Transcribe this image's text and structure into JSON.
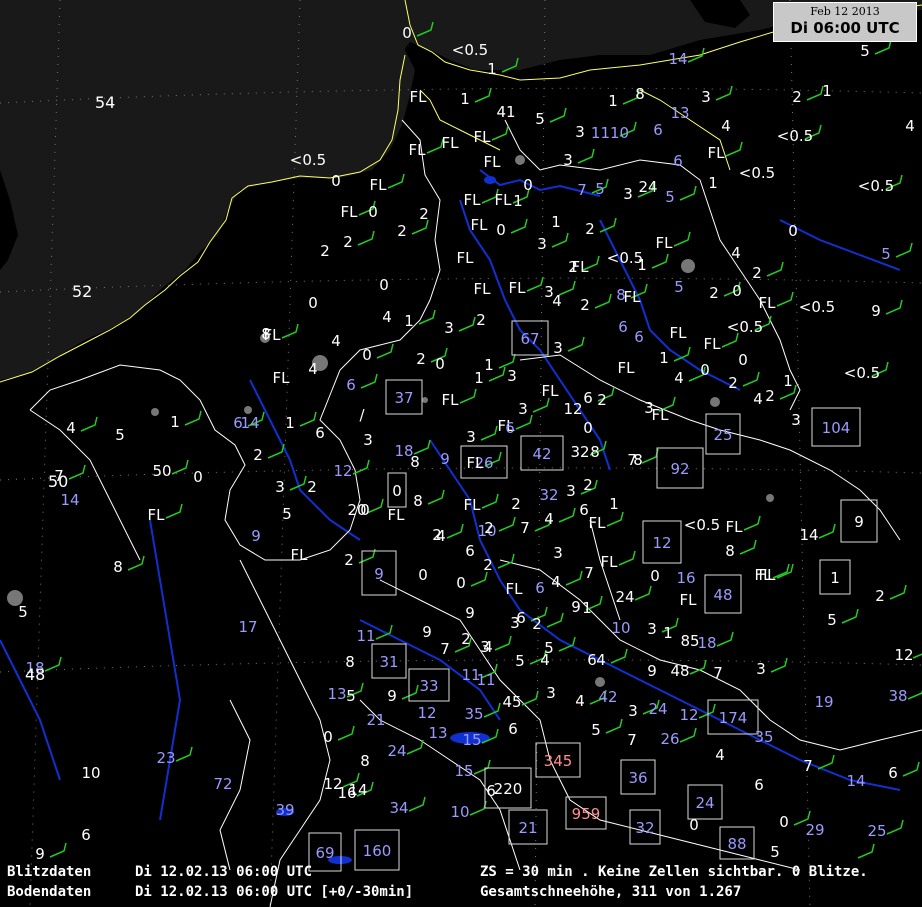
{
  "header": {
    "date": "Feb 12 2013",
    "time": "Di 06:00 UTC"
  },
  "latitude_labels": [
    "54",
    "52",
    "50",
    "48"
  ],
  "footer": {
    "row1_label": "Blitzdaten",
    "row1_time": "Di 12.02.13 06:00 UTC",
    "row1_info": "ZS = 30 min . Keine Zellen sichtbar. 0 Blitze.",
    "row2_label": "Bodendaten",
    "row2_time": "Di 12.02.13 06:00 UTC [+0/-30min]",
    "row2_info": "Gesamtschneehöhe, 311 von 1.267"
  },
  "colors": {
    "land": "#191919",
    "sea": "#000000",
    "coast": "#ffff66",
    "border": "#ffffff",
    "river": "#1030d0",
    "wind": "#22cc22",
    "value_white": "#ffffff",
    "value_blue": "#9a9aff",
    "value_red": "#ff8f8f"
  },
  "observations": [
    {
      "t": "0",
      "c": "w"
    },
    {
      "t": "<0.5",
      "c": "w"
    },
    {
      "t": "1",
      "c": "w"
    },
    {
      "t": "FL",
      "c": "w"
    },
    {
      "t": "1",
      "c": "w"
    },
    {
      "t": "41",
      "c": "w"
    },
    {
      "t": "5",
      "c": "w"
    },
    {
      "t": "3",
      "c": "w"
    },
    {
      "t": "1110",
      "c": "b"
    },
    {
      "t": "6",
      "c": "b"
    },
    {
      "t": "1",
      "c": "w"
    },
    {
      "t": "8",
      "c": "w"
    },
    {
      "t": "14",
      "c": "b"
    },
    {
      "t": "13",
      "c": "b"
    },
    {
      "t": "3",
      "c": "w"
    },
    {
      "t": "4",
      "c": "w"
    },
    {
      "t": "2",
      "c": "w"
    },
    {
      "t": "1",
      "c": "w"
    },
    {
      "t": "5",
      "c": "w"
    },
    {
      "t": "4",
      "c": "w"
    },
    {
      "t": "FL",
      "c": "w"
    },
    {
      "t": "FL",
      "c": "w"
    },
    {
      "t": "FL",
      "c": "w"
    },
    {
      "t": "FL",
      "c": "w"
    },
    {
      "t": "3",
      "c": "w"
    },
    {
      "t": "6",
      "c": "b"
    },
    {
      "t": "FL",
      "c": "w"
    },
    {
      "t": "<0.5",
      "c": "w"
    },
    {
      "t": "<0.5",
      "c": "w"
    },
    {
      "t": "<0.5",
      "c": "w"
    },
    {
      "t": "<0.5",
      "c": "w"
    },
    {
      "t": "0",
      "c": "w"
    },
    {
      "t": "FL",
      "c": "w"
    },
    {
      "t": "0",
      "c": "w"
    },
    {
      "t": "7",
      "c": "b"
    },
    {
      "t": "5",
      "c": "b"
    },
    {
      "t": "3",
      "c": "w"
    },
    {
      "t": "24",
      "c": "w"
    },
    {
      "t": "5",
      "c": "b"
    },
    {
      "t": "1",
      "c": "w"
    },
    {
      "t": "FL",
      "c": "w"
    },
    {
      "t": "0",
      "c": "w"
    },
    {
      "t": "FL",
      "c": "w"
    },
    {
      "t": "1",
      "c": "w"
    },
    {
      "t": "2",
      "c": "w"
    },
    {
      "t": "2",
      "c": "w"
    },
    {
      "t": "FL",
      "c": "w"
    },
    {
      "t": "FL",
      "c": "w"
    },
    {
      "t": "0",
      "c": "w"
    },
    {
      "t": "1",
      "c": "w"
    },
    {
      "t": "2",
      "c": "w"
    },
    {
      "t": "0",
      "c": "w"
    },
    {
      "t": "5",
      "c": "b"
    },
    {
      "t": "2",
      "c": "w"
    },
    {
      "t": "2",
      "c": "w"
    },
    {
      "t": "<0.5",
      "c": "w"
    },
    {
      "t": "1",
      "c": "w"
    },
    {
      "t": "FL",
      "c": "w"
    },
    {
      "t": "FL",
      "c": "w"
    },
    {
      "t": "4",
      "c": "w"
    },
    {
      "t": "3",
      "c": "w"
    },
    {
      "t": "5",
      "c": "b"
    },
    {
      "t": "2",
      "c": "w"
    },
    {
      "t": "FL",
      "c": "w"
    },
    {
      "t": "2",
      "c": "w"
    },
    {
      "t": "FL",
      "c": "w"
    },
    {
      "t": "2",
      "c": "w"
    },
    {
      "t": "0",
      "c": "w"
    },
    {
      "t": "FL",
      "c": "w"
    },
    {
      "t": "0",
      "c": "w"
    },
    {
      "t": "3",
      "c": "w"
    },
    {
      "t": "4",
      "c": "w"
    },
    {
      "t": "2",
      "c": "w"
    },
    {
      "t": "6",
      "c": "b"
    },
    {
      "t": "8",
      "c": "b"
    },
    {
      "t": "FL",
      "c": "w"
    },
    {
      "t": "FL",
      "c": "w"
    },
    {
      "t": "4",
      "c": "w"
    },
    {
      "t": "1",
      "c": "w"
    },
    {
      "t": "0",
      "c": "w"
    },
    {
      "t": "3",
      "c": "w"
    },
    {
      "t": "2",
      "c": "w"
    },
    {
      "t": "3",
      "c": "w"
    },
    {
      "t": "6",
      "c": "b"
    },
    {
      "t": "1",
      "c": "w"
    },
    {
      "t": "FL",
      "c": "w"
    },
    {
      "t": "<0.5",
      "c": "w"
    },
    {
      "t": "<0.5",
      "c": "w"
    },
    {
      "t": "9",
      "c": "w"
    },
    {
      "t": "8",
      "c": "w"
    },
    {
      "t": "FL",
      "c": "w"
    },
    {
      "t": "4",
      "c": "w"
    },
    {
      "t": "0",
      "c": "w"
    },
    {
      "t": "4",
      "c": "w"
    },
    {
      "t": "2",
      "c": "w"
    },
    {
      "t": "0",
      "c": "w"
    },
    {
      "t": "1",
      "c": "w"
    },
    {
      "t": "3",
      "c": "w"
    },
    {
      "t": "1",
      "c": "w"
    },
    {
      "t": "FL",
      "c": "w"
    },
    {
      "t": "FL",
      "c": "w"
    },
    {
      "t": "0",
      "c": "w"
    },
    {
      "t": "4",
      "c": "w"
    },
    {
      "t": "0",
      "c": "w"
    },
    {
      "t": "<0.5",
      "c": "w"
    },
    {
      "t": "FL",
      "c": "w"
    },
    {
      "t": "6",
      "c": "b"
    },
    {
      "t": "FL",
      "c": "w"
    },
    {
      "t": "2",
      "c": "w"
    },
    {
      "t": "1",
      "c": "w"
    },
    {
      "t": "FL",
      "c": "w"
    },
    {
      "t": "4",
      "c": "w"
    },
    {
      "t": "6",
      "c": "w"
    },
    {
      "t": "2",
      "c": "w"
    },
    {
      "t": "3",
      "c": "w"
    },
    {
      "t": "FL",
      "c": "w"
    },
    {
      "t": "3",
      "c": "w"
    },
    {
      "t": "12",
      "c": "w"
    },
    {
      "t": "2",
      "c": "w"
    },
    {
      "t": "3",
      "c": "w"
    },
    {
      "t": "4",
      "c": "w"
    },
    {
      "t": "5",
      "c": "w"
    },
    {
      "t": "1",
      "c": "w"
    },
    {
      "t": "/",
      "c": "w"
    },
    {
      "t": "6",
      "c": "b"
    },
    {
      "t": "14",
      "c": "b"
    },
    {
      "t": "1",
      "c": "w"
    },
    {
      "t": "6",
      "c": "w"
    },
    {
      "t": "FL",
      "c": "w"
    },
    {
      "t": "0",
      "c": "w"
    },
    {
      "t": "3",
      "c": "w"
    },
    {
      "t": "6",
      "c": "b"
    },
    {
      "t": "2",
      "c": "w"
    },
    {
      "t": "3",
      "c": "w"
    },
    {
      "t": "18",
      "c": "b"
    },
    {
      "t": "9",
      "c": "b"
    },
    {
      "t": "32",
      "c": "w"
    },
    {
      "t": "8",
      "c": "w"
    },
    {
      "t": "7",
      "c": "w"
    },
    {
      "t": "8",
      "c": "w"
    },
    {
      "t": "7",
      "c": "w"
    },
    {
      "t": "14",
      "c": "b"
    },
    {
      "t": "50",
      "c": "w"
    },
    {
      "t": "0",
      "c": "w"
    },
    {
      "t": "3",
      "c": "w"
    },
    {
      "t": "2",
      "c": "w"
    },
    {
      "t": "12",
      "c": "b"
    },
    {
      "t": "8",
      "c": "w"
    },
    {
      "t": "FL",
      "c": "w"
    },
    {
      "t": "2",
      "c": "w"
    },
    {
      "t": "3",
      "c": "w"
    },
    {
      "t": "32",
      "c": "b"
    },
    {
      "t": "FL",
      "c": "w"
    },
    {
      "t": "5",
      "c": "w"
    },
    {
      "t": "20",
      "c": "w"
    },
    {
      "t": "0",
      "c": "w"
    },
    {
      "t": "8",
      "c": "w"
    },
    {
      "t": "FL",
      "c": "w"
    },
    {
      "t": "FL",
      "c": "w"
    },
    {
      "t": "2",
      "c": "w"
    },
    {
      "t": "4",
      "c": "w"
    },
    {
      "t": "6",
      "c": "w"
    },
    {
      "t": "FL",
      "c": "w"
    },
    {
      "t": "10",
      "c": "b"
    },
    {
      "t": "7",
      "c": "w"
    },
    {
      "t": "1",
      "c": "w"
    },
    {
      "t": "FL",
      "c": "w"
    },
    {
      "t": "9",
      "c": "b"
    },
    {
      "t": "2",
      "c": "w"
    },
    {
      "t": "4",
      "c": "w"
    },
    {
      "t": "2",
      "c": "w"
    },
    {
      "t": "<0.5",
      "c": "w"
    },
    {
      "t": "14",
      "c": "w"
    },
    {
      "t": "FL",
      "c": "w"
    },
    {
      "t": "2",
      "c": "w"
    },
    {
      "t": "6",
      "c": "w"
    },
    {
      "t": "2",
      "c": "w"
    },
    {
      "t": "3",
      "c": "w"
    },
    {
      "t": "FL",
      "c": "w"
    },
    {
      "t": "0",
      "c": "w"
    },
    {
      "t": "8",
      "c": "w"
    },
    {
      "t": "7",
      "c": "w"
    },
    {
      "t": "4",
      "c": "w"
    },
    {
      "t": "6",
      "c": "b"
    },
    {
      "t": "FL",
      "c": "w"
    },
    {
      "t": "16",
      "c": "b"
    },
    {
      "t": "FL",
      "c": "w"
    },
    {
      "t": "0",
      "c": "w"
    },
    {
      "t": "0",
      "c": "w"
    },
    {
      "t": "FL",
      "c": "w"
    },
    {
      "t": "24",
      "c": "w"
    },
    {
      "t": "FL",
      "c": "w"
    },
    {
      "t": "8",
      "c": "w"
    },
    {
      "t": "5",
      "c": "w"
    },
    {
      "t": "9",
      "c": "w"
    },
    {
      "t": "1",
      "c": "w"
    },
    {
      "t": "2",
      "c": "w"
    },
    {
      "t": "17",
      "c": "b"
    },
    {
      "t": "11",
      "c": "b"
    },
    {
      "t": "9",
      "c": "w"
    },
    {
      "t": "7",
      "c": "w"
    },
    {
      "t": "9",
      "c": "w"
    },
    {
      "t": "6",
      "c": "w"
    },
    {
      "t": "3",
      "c": "w"
    },
    {
      "t": "2",
      "c": "w"
    },
    {
      "t": "2",
      "c": "w"
    },
    {
      "t": "3",
      "c": "w"
    },
    {
      "t": "10",
      "c": "b"
    },
    {
      "t": "3",
      "c": "w"
    },
    {
      "t": "1",
      "c": "w"
    },
    {
      "t": "18",
      "c": "b"
    },
    {
      "t": "85",
      "c": "w"
    },
    {
      "t": "5",
      "c": "w"
    },
    {
      "t": "4",
      "c": "w"
    },
    {
      "t": "5",
      "c": "w"
    },
    {
      "t": "4",
      "c": "w"
    },
    {
      "t": "5",
      "c": "w"
    },
    {
      "t": "6",
      "c": "w"
    },
    {
      "t": "4",
      "c": "w"
    },
    {
      "t": "9",
      "c": "w"
    },
    {
      "t": "48",
      "c": "w"
    },
    {
      "t": "7",
      "c": "w"
    },
    {
      "t": "3",
      "c": "w"
    },
    {
      "t": "12",
      "c": "w"
    },
    {
      "t": "18",
      "c": "b"
    },
    {
      "t": "8",
      "c": "w"
    },
    {
      "t": "13",
      "c": "b"
    },
    {
      "t": "5",
      "c": "w"
    },
    {
      "t": "9",
      "c": "w"
    },
    {
      "t": "12",
      "c": "b"
    },
    {
      "t": "11",
      "c": "b"
    },
    {
      "t": "11",
      "c": "b"
    },
    {
      "t": "45",
      "c": "w"
    },
    {
      "t": "3",
      "c": "w"
    },
    {
      "t": "4",
      "c": "w"
    },
    {
      "t": "42",
      "c": "b"
    },
    {
      "t": "3",
      "c": "w"
    },
    {
      "t": "24",
      "c": "b"
    },
    {
      "t": "12",
      "c": "b"
    },
    {
      "t": "19",
      "c": "b"
    },
    {
      "t": "38",
      "c": "b"
    },
    {
      "t": "21",
      "c": "b"
    },
    {
      "t": "35",
      "c": "b"
    },
    {
      "t": "6",
      "c": "w"
    },
    {
      "t": "5",
      "c": "w"
    },
    {
      "t": "7",
      "c": "w"
    },
    {
      "t": "26",
      "c": "b"
    },
    {
      "t": "35",
      "c": "b"
    },
    {
      "t": "0",
      "c": "w"
    },
    {
      "t": "13",
      "c": "b"
    },
    {
      "t": "15",
      "c": "b"
    },
    {
      "t": "4",
      "c": "w"
    },
    {
      "t": "23",
      "c": "b"
    },
    {
      "t": "8",
      "c": "w"
    },
    {
      "t": "24",
      "c": "b"
    },
    {
      "t": "10",
      "c": "w"
    },
    {
      "t": "12",
      "c": "w"
    },
    {
      "t": "14",
      "c": "w"
    },
    {
      "t": "15",
      "c": "b"
    },
    {
      "t": "6",
      "c": "w"
    },
    {
      "t": "16",
      "c": "w"
    },
    {
      "t": "6",
      "c": "w"
    },
    {
      "t": "7",
      "c": "w"
    },
    {
      "t": "14",
      "c": "b"
    },
    {
      "t": "6",
      "c": "w"
    },
    {
      "t": "72",
      "c": "b"
    },
    {
      "t": "34",
      "c": "b"
    },
    {
      "t": "39",
      "c": "b"
    },
    {
      "t": "10",
      "c": "b"
    },
    {
      "t": "0",
      "c": "w"
    },
    {
      "t": "0",
      "c": "w"
    },
    {
      "t": "29",
      "c": "b"
    },
    {
      "t": "25",
      "c": "b"
    },
    {
      "t": "6",
      "c": "w"
    },
    {
      "t": "9",
      "c": "w"
    },
    {
      "t": "5",
      "c": "w"
    }
  ],
  "boxed_observations": [
    {
      "t": "67",
      "c": "b"
    },
    {
      "t": "37",
      "c": "b"
    },
    {
      "t": "42",
      "c": "b"
    },
    {
      "t": "26",
      "c": "b"
    },
    {
      "t": "92",
      "c": "b"
    },
    {
      "t": "25",
      "c": "b"
    },
    {
      "t": "104",
      "c": "b"
    },
    {
      "t": "0",
      "c": "w"
    },
    {
      "t": "9",
      "c": "w"
    },
    {
      "t": "12",
      "c": "b"
    },
    {
      "t": "9",
      "c": "b"
    },
    {
      "t": "48",
      "c": "b"
    },
    {
      "t": "1",
      "c": "w"
    },
    {
      "t": "31",
      "c": "b"
    },
    {
      "t": "33",
      "c": "b"
    },
    {
      "t": "174",
      "c": "b"
    },
    {
      "t": "345",
      "c": "r"
    },
    {
      "t": "36",
      "c": "b"
    },
    {
      "t": "220",
      "c": "w"
    },
    {
      "t": "959",
      "c": "r"
    },
    {
      "t": "24",
      "c": "b"
    },
    {
      "t": "21",
      "c": "b"
    },
    {
      "t": "32",
      "c": "b"
    },
    {
      "t": "88",
      "c": "b"
    },
    {
      "t": "69",
      "c": "b"
    },
    {
      "t": "160",
      "c": "b"
    }
  ]
}
